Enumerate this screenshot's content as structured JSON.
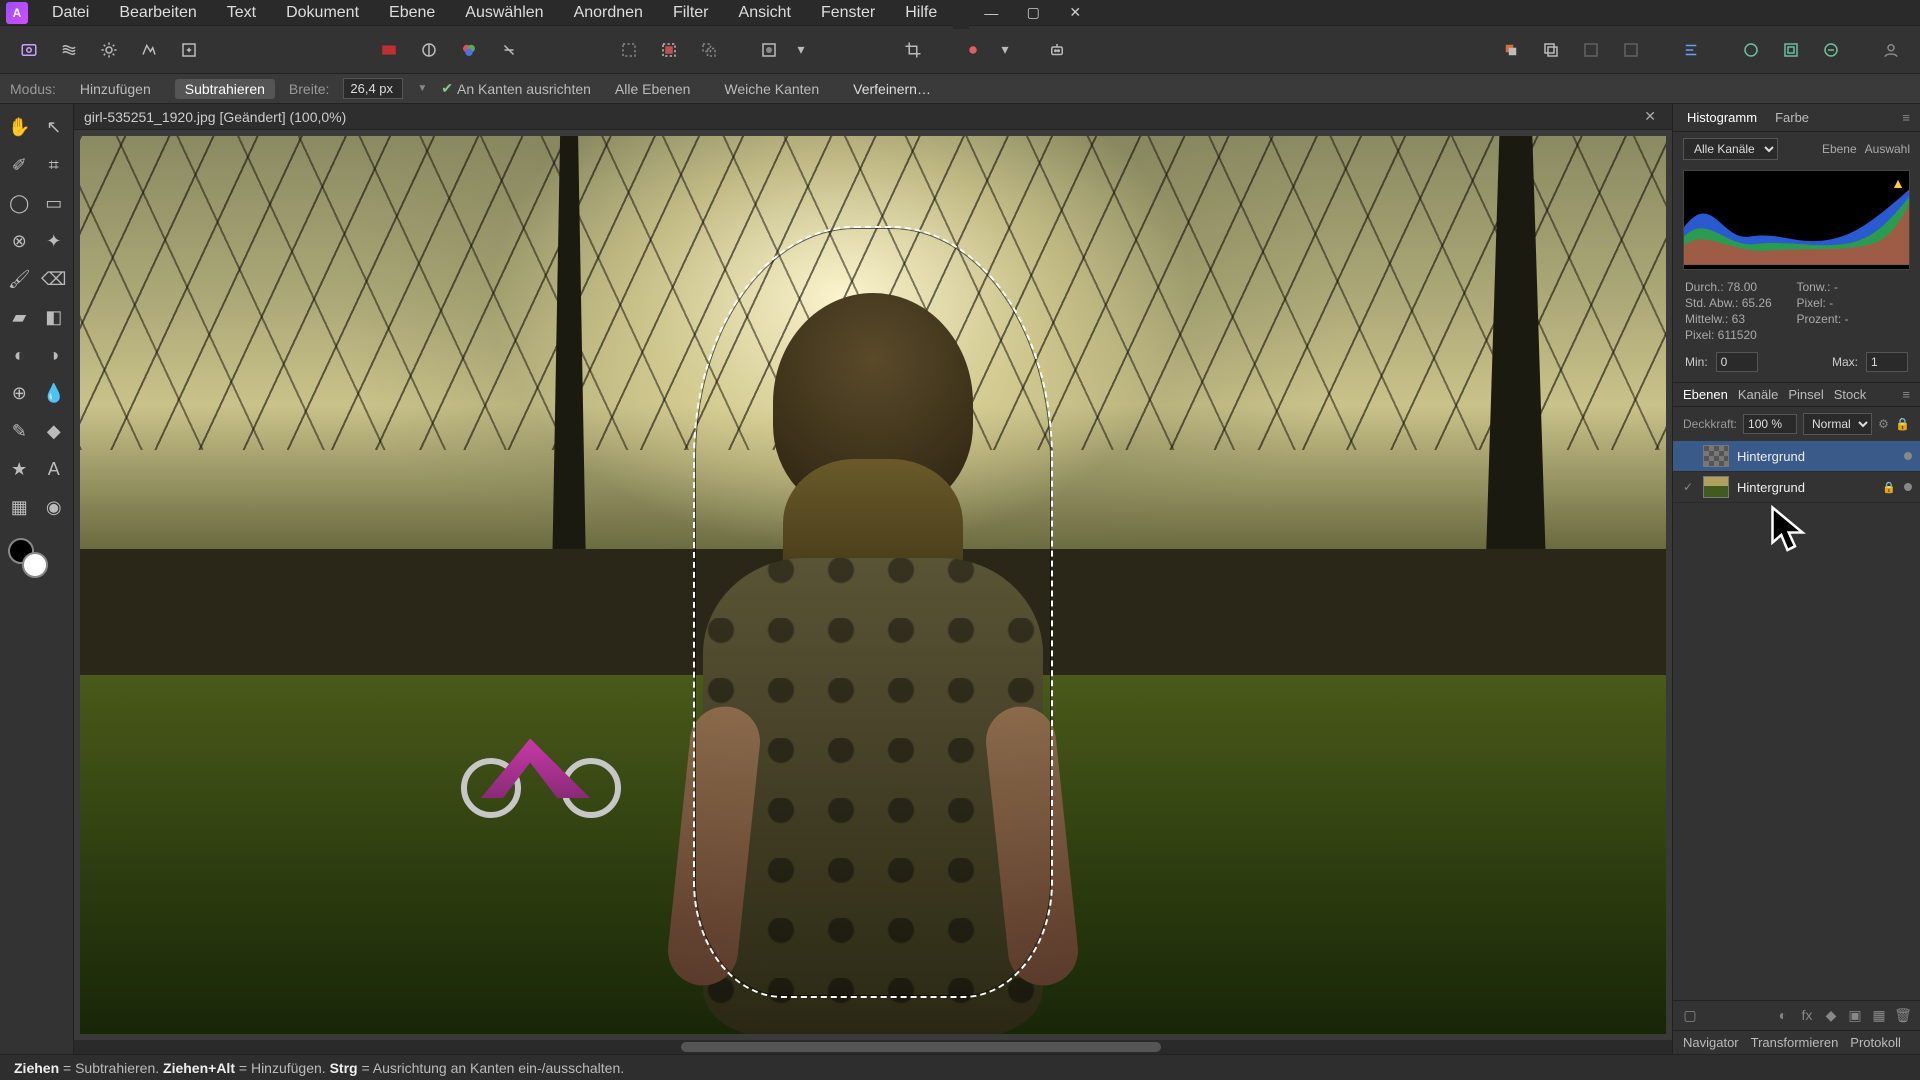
{
  "menu": {
    "items": [
      "Datei",
      "Bearbeiten",
      "Text",
      "Dokument",
      "Ebene",
      "Auswählen",
      "Anordnen",
      "Filter",
      "Ansicht",
      "Fenster",
      "Hilfe"
    ]
  },
  "context": {
    "modeLabel": "Modus:",
    "add": "Hinzufügen",
    "sub": "Subtrahieren",
    "widthLabel": "Breite:",
    "widthValue": "26,4 px",
    "snap": "An Kanten ausrichten",
    "allLayers": "Alle Ebenen",
    "soft": "Weiche Kanten",
    "refine": "Verfeinern…"
  },
  "doc": {
    "title": "girl-535251_1920.jpg [Geändert] (100,0%)"
  },
  "panels": {
    "hist": {
      "tabs": [
        "Histogramm",
        "Farbe"
      ],
      "channel": "Alle Kanäle",
      "layerBtn": "Ebene",
      "selBtn": "Auswahl",
      "mean": "Durch.: 78.00",
      "std": "Std. Abw.: 65.26",
      "median": "Mittelw.: 63",
      "pixel": "Pixel: 611520",
      "tonal": "Tonw.: -",
      "pix2": "Pixel: -",
      "pct": "Prozent: -",
      "minLabel": "Min:",
      "minValue": "0",
      "maxLabel": "Max:",
      "maxValue": "1"
    },
    "layers": {
      "tabs": [
        "Ebenen",
        "Kanäle",
        "Pinsel",
        "Stock"
      ],
      "opacityLabel": "Deckkraft:",
      "opacityValue": "100 %",
      "blend": "Normal",
      "items": [
        {
          "name": "Hintergrund",
          "selected": true,
          "type": "mask"
        },
        {
          "name": "Hintergrund",
          "selected": false,
          "type": "pixel"
        }
      ]
    },
    "bottom": [
      "Navigator",
      "Transformieren",
      "Protokoll"
    ]
  },
  "status": {
    "drag": "Ziehen",
    "dragTxt": " = Subtrahieren. ",
    "alt": "Ziehen+Alt",
    "altTxt": " = Hinzufügen. ",
    "ctrl": "Strg",
    "ctrlTxt": " = Ausrichtung an Kanten ein-/ausschalten."
  }
}
